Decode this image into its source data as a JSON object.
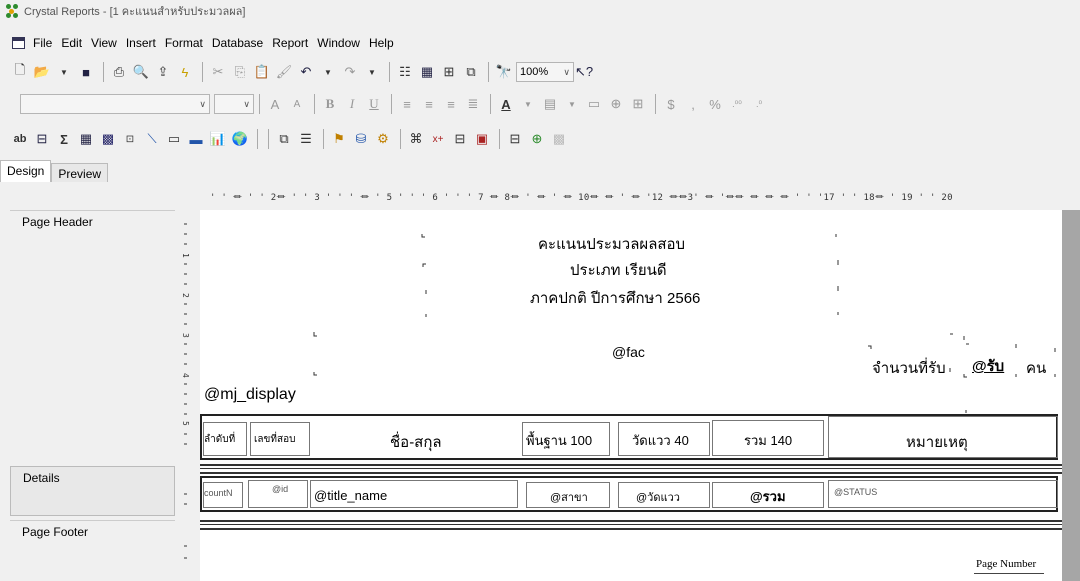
{
  "window": {
    "title": "Crystal Reports - [1 คะแนนสำหรับประมวลผล]"
  },
  "menu": {
    "items": [
      "File",
      "Edit",
      "View",
      "Insert",
      "Format",
      "Database",
      "Report",
      "Window",
      "Help"
    ]
  },
  "toolbar": {
    "zoom": "100%"
  },
  "tabs": {
    "design": "Design",
    "preview": "Preview"
  },
  "ruler": {
    "text": "' ' ⏛ ' ' 2⏛ ' ' 3 ' ' ' ⏛ ' 5 ' ' ' 6 ' ' ' 7 ⏛ 8⏛ ' ⏛ ' ⏛ 10⏛ ⏛ ' ⏛ '12 ⏛⏛3' ⏛ '⏛⏛ ⏛ ⏛ ⏛ ' ' '17 ' ' 18⏛ ' 19 ' ' 20"
  },
  "sections": {
    "page_header": "Page Header",
    "details": "Details",
    "page_footer": "Page Footer"
  },
  "header": {
    "title1": "คะแนนประมวลผลสอบ",
    "title2": "ประเภท  เรียนดี",
    "title3": "ภาคปกติ  ปีการศึกษา 2566",
    "fac": "@fac",
    "seats_label": "จำนวนที่รับ",
    "seats_field": "@รับ",
    "seats_unit": "คน",
    "mj_display": "@mj_display"
  },
  "columns": {
    "seq": "ลำดับที่",
    "exam_no": "เลขที่สอบ",
    "name": "ชื่อ-สกุล",
    "basic": "พื้นฐาน 100",
    "measure": "วัดแวว 40",
    "total": "รวม 140",
    "note": "หมายเหตุ"
  },
  "details": {
    "count": "countN",
    "id": "@id",
    "title_name": "@title_name",
    "branch": "@สาขา",
    "measure": "@วัดแวว",
    "total": "@รวม",
    "status": "@STATUS"
  },
  "footer": {
    "page_number": "Page Number"
  }
}
